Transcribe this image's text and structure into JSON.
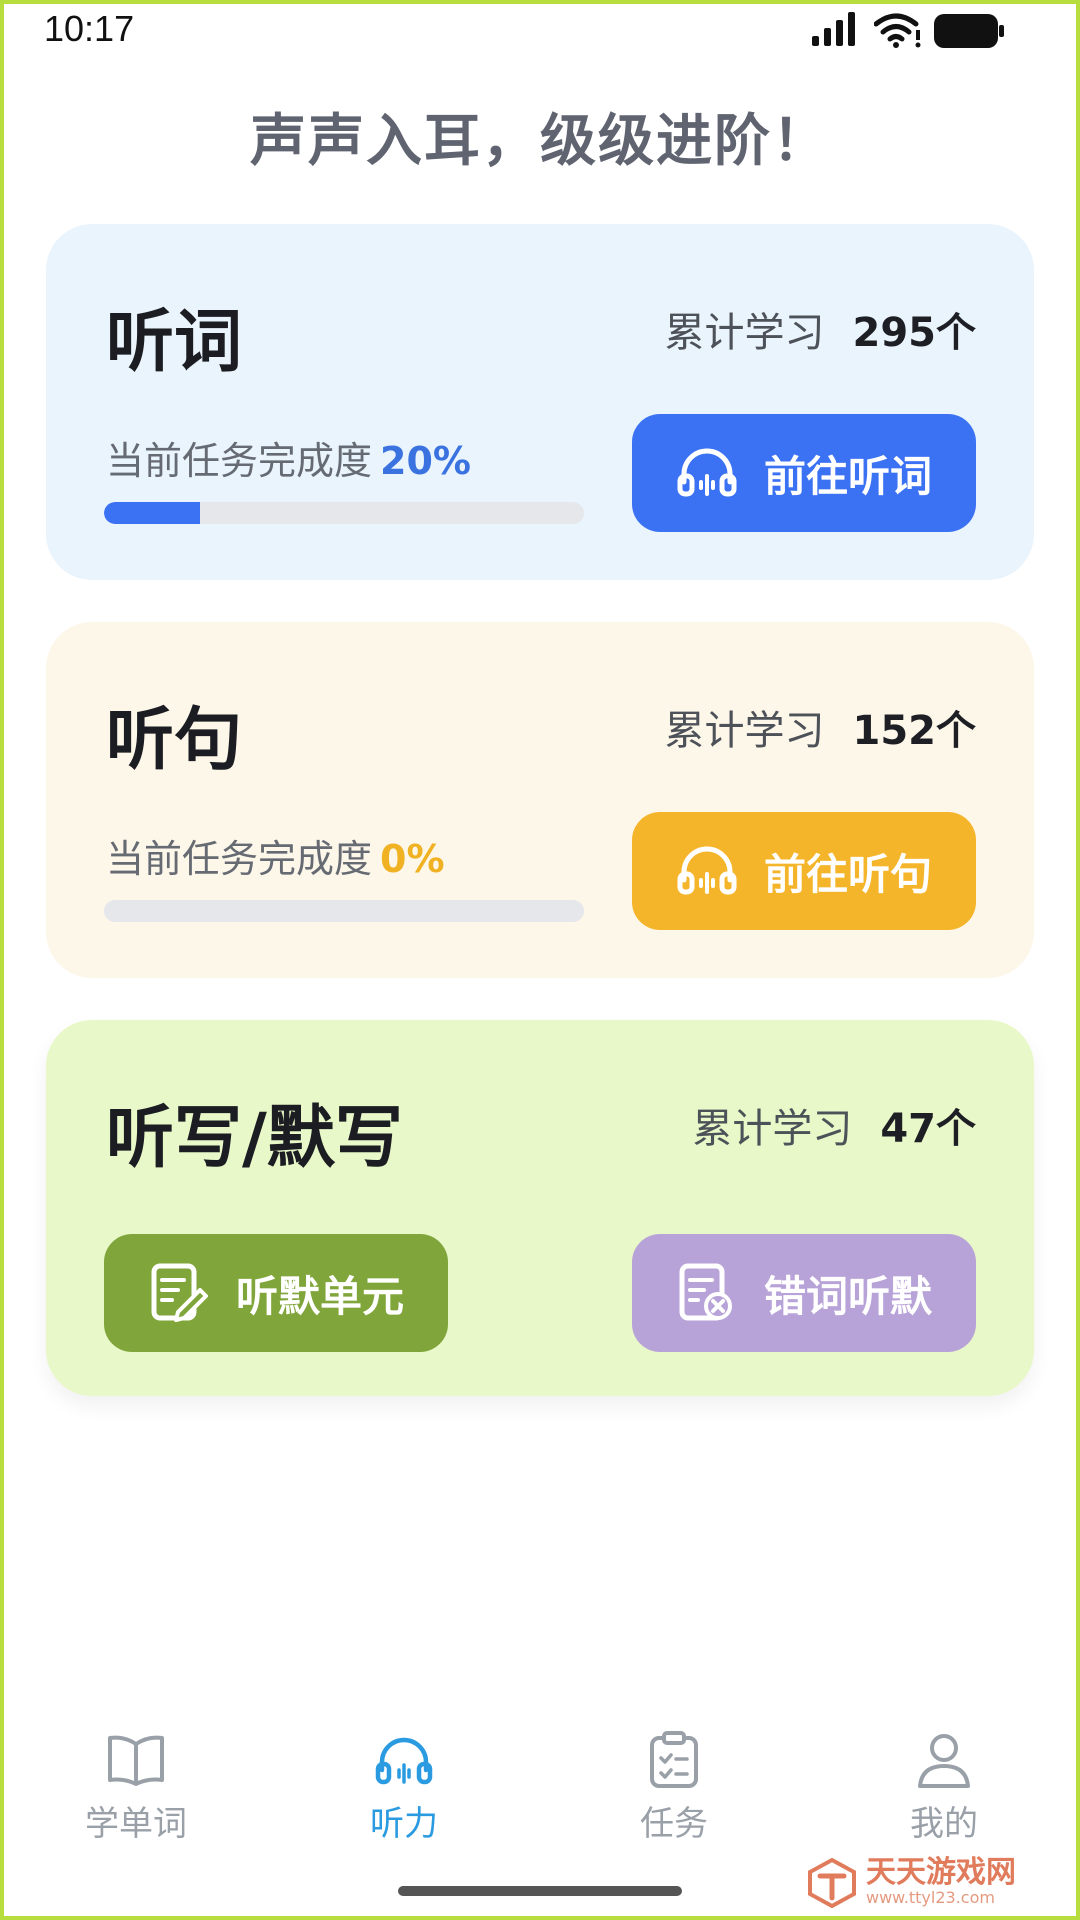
{
  "status_bar": {
    "time": "10:17"
  },
  "headline": "声声入耳，级级进阶！",
  "cards": {
    "words": {
      "title": "听词",
      "stats_label": "累计学习",
      "stats_value": "295个",
      "progress_label": "当前任务完成度",
      "progress_value": "20%",
      "progress_fraction": 0.2,
      "button_label": "前往听词"
    },
    "sentences": {
      "title": "听句",
      "stats_label": "累计学习",
      "stats_value": "152个",
      "progress_label": "当前任务完成度",
      "progress_value": "0%",
      "progress_fraction": 0,
      "button_label": "前往听句"
    },
    "dictation": {
      "title": "听写/默写",
      "stats_label": "累计学习",
      "stats_value": "47个",
      "unit_button_label": "听默单元",
      "wrong_button_label": "错词听默"
    }
  },
  "tabbar": {
    "items": [
      {
        "label": "学单词",
        "icon": "book-icon"
      },
      {
        "label": "听力",
        "icon": "headphones-icon",
        "active": true
      },
      {
        "label": "任务",
        "icon": "clipboard-icon"
      },
      {
        "label": "我的",
        "icon": "user-icon"
      }
    ]
  },
  "watermark": {
    "title": "天天游戏网",
    "url": "www.ttyl23.com"
  },
  "colors": {
    "accent_blue": "#3b72f4",
    "accent_yellow": "#f5b52a",
    "accent_green": "#80a53a",
    "accent_purple": "#b8a3d8",
    "tab_active": "#2a9be0"
  }
}
